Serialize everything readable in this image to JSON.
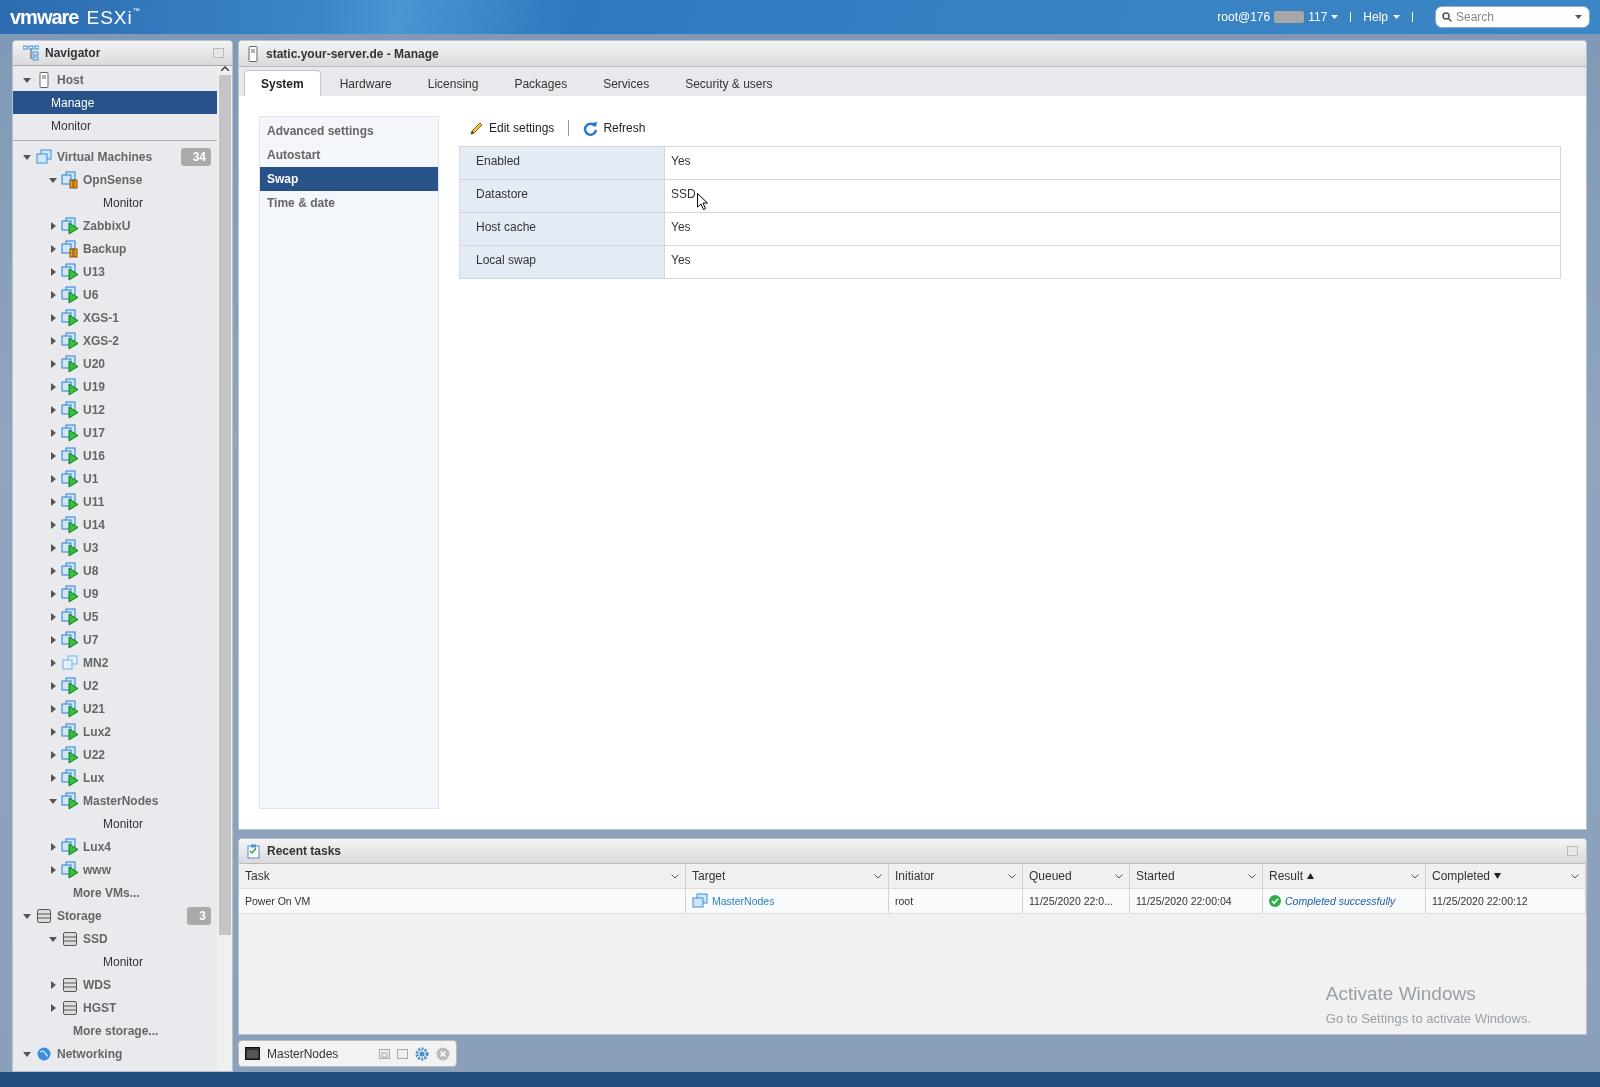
{
  "header": {
    "brand": "vmware",
    "product": "ESXi",
    "trademark": "™",
    "user": {
      "prefix": "root@176",
      "suffix": "117",
      "redacted": true
    },
    "help": "Help",
    "search": {
      "placeholder": "Search"
    }
  },
  "navigator": {
    "title": "Navigator",
    "sections": [
      {
        "label": "Host",
        "kind": "host",
        "expanded": true,
        "children": [
          {
            "kind": "page",
            "label": "Manage",
            "selected": true
          },
          {
            "kind": "page",
            "label": "Monitor",
            "selected": false
          }
        ]
      },
      {
        "label": "Virtual Machines",
        "kind": "vms",
        "badge": "34",
        "expanded": true,
        "children": [
          {
            "kind": "vm",
            "label": "OpnSense",
            "powered_on": false,
            "suspended": true,
            "expanded": true,
            "children": [
              {
                "kind": "page",
                "label": "Monitor",
                "selected": false
              }
            ]
          },
          {
            "kind": "vm",
            "label": "ZabbixU",
            "powered_on": true,
            "suspended": false,
            "expanded": false
          },
          {
            "kind": "vm",
            "label": "Backup",
            "powered_on": false,
            "suspended": true,
            "expanded": false
          },
          {
            "kind": "vm",
            "label": "U13",
            "powered_on": true,
            "suspended": false,
            "expanded": false
          },
          {
            "kind": "vm",
            "label": "U6",
            "powered_on": true,
            "suspended": false,
            "expanded": false
          },
          {
            "kind": "vm",
            "label": "XGS-1",
            "powered_on": true,
            "suspended": false,
            "expanded": false
          },
          {
            "kind": "vm",
            "label": "XGS-2",
            "powered_on": true,
            "suspended": false,
            "expanded": false
          },
          {
            "kind": "vm",
            "label": "U20",
            "powered_on": true,
            "suspended": false,
            "expanded": false
          },
          {
            "kind": "vm",
            "label": "U19",
            "powered_on": true,
            "suspended": false,
            "expanded": false
          },
          {
            "kind": "vm",
            "label": "U12",
            "powered_on": true,
            "suspended": false,
            "expanded": false
          },
          {
            "kind": "vm",
            "label": "U17",
            "powered_on": true,
            "suspended": false,
            "expanded": false
          },
          {
            "kind": "vm",
            "label": "U16",
            "powered_on": true,
            "suspended": false,
            "expanded": false
          },
          {
            "kind": "vm",
            "label": "U1",
            "powered_on": true,
            "suspended": false,
            "expanded": false
          },
          {
            "kind": "vm",
            "label": "U11",
            "powered_on": true,
            "suspended": false,
            "expanded": false
          },
          {
            "kind": "vm",
            "label": "U14",
            "powered_on": true,
            "suspended": false,
            "expanded": false
          },
          {
            "kind": "vm",
            "label": "U3",
            "powered_on": true,
            "suspended": false,
            "expanded": false
          },
          {
            "kind": "vm",
            "label": "U8",
            "powered_on": true,
            "suspended": false,
            "expanded": false
          },
          {
            "kind": "vm",
            "label": "U9",
            "powered_on": true,
            "suspended": false,
            "expanded": false
          },
          {
            "kind": "vm",
            "label": "U5",
            "powered_on": true,
            "suspended": false,
            "expanded": false
          },
          {
            "kind": "vm",
            "label": "U7",
            "powered_on": true,
            "suspended": false,
            "expanded": false
          },
          {
            "kind": "vm",
            "label": "MN2",
            "powered_on": false,
            "suspended": false,
            "expanded": false
          },
          {
            "kind": "vm",
            "label": "U2",
            "powered_on": true,
            "suspended": false,
            "expanded": false
          },
          {
            "kind": "vm",
            "label": "U21",
            "powered_on": true,
            "suspended": false,
            "expanded": false
          },
          {
            "kind": "vm",
            "label": "Lux2",
            "powered_on": true,
            "suspended": false,
            "expanded": false
          },
          {
            "kind": "vm",
            "label": "U22",
            "powered_on": true,
            "suspended": false,
            "expanded": false
          },
          {
            "kind": "vm",
            "label": "Lux",
            "powered_on": true,
            "suspended": false,
            "expanded": false
          },
          {
            "kind": "vm",
            "label": "MasterNodes",
            "powered_on": true,
            "suspended": false,
            "expanded": true,
            "children": [
              {
                "kind": "page",
                "label": "Monitor",
                "selected": false
              }
            ]
          },
          {
            "kind": "vm",
            "label": "Lux4",
            "powered_on": true,
            "suspended": false,
            "expanded": false
          },
          {
            "kind": "vm",
            "label": "www",
            "powered_on": true,
            "suspended": false,
            "expanded": false
          },
          {
            "kind": "more",
            "label": "More VMs..."
          }
        ]
      },
      {
        "label": "Storage",
        "kind": "storage",
        "badge": "3",
        "expanded": true,
        "children": [
          {
            "kind": "datastore",
            "label": "SSD",
            "expanded": true,
            "children": [
              {
                "kind": "page",
                "label": "Monitor",
                "selected": false
              }
            ]
          },
          {
            "kind": "datastore",
            "label": "WDS",
            "expanded": false
          },
          {
            "kind": "datastore",
            "label": "HGST",
            "expanded": false
          },
          {
            "kind": "more",
            "label": "More storage..."
          }
        ]
      },
      {
        "label": "Networking",
        "kind": "network",
        "expanded": true
      }
    ]
  },
  "manage": {
    "title": "static.your-server.de - Manage",
    "tabs": [
      {
        "label": "System",
        "selected": true
      },
      {
        "label": "Hardware",
        "selected": false
      },
      {
        "label": "Licensing",
        "selected": false
      },
      {
        "label": "Packages",
        "selected": false
      },
      {
        "label": "Services",
        "selected": false
      },
      {
        "label": "Security & users",
        "selected": false
      }
    ],
    "side_menu": [
      {
        "label": "Advanced settings",
        "selected": false
      },
      {
        "label": "Autostart",
        "selected": false
      },
      {
        "label": "Swap",
        "selected": true
      },
      {
        "label": "Time & date",
        "selected": false
      }
    ],
    "toolbar": [
      {
        "kind": "edit",
        "label": "Edit settings"
      },
      {
        "kind": "refresh",
        "label": "Refresh"
      }
    ],
    "properties": [
      {
        "label": "Enabled",
        "value": "Yes"
      },
      {
        "label": "Datastore",
        "value": "SSD"
      },
      {
        "label": "Host cache",
        "value": "Yes"
      },
      {
        "label": "Local swap",
        "value": "Yes"
      }
    ]
  },
  "recent_tasks": {
    "title": "Recent tasks",
    "columns": [
      {
        "label": "Task",
        "sorted": false
      },
      {
        "label": "Target",
        "sorted": false
      },
      {
        "label": "Initiator",
        "sorted": false
      },
      {
        "label": "Queued",
        "sorted": false
      },
      {
        "label": "Started",
        "sorted": false
      },
      {
        "label": "Result",
        "sorted": true,
        "descending": false
      },
      {
        "label": "Completed",
        "sorted": true,
        "descending": true
      }
    ],
    "rows": [
      {
        "task": "Power On VM",
        "target": "MasterNodes",
        "initiator": "root",
        "queued": "11/25/2020 22:0...",
        "started": "11/25/2020 22:00:04",
        "result": {
          "succeeded": true,
          "text": "Completed successfully"
        },
        "completed": "11/25/2020 22:00:12"
      }
    ]
  },
  "minimized_window": {
    "title": "MasterNodes"
  },
  "os_notice": {
    "title": "Activate Windows",
    "text": "Go to Settings to activate Windows."
  }
}
